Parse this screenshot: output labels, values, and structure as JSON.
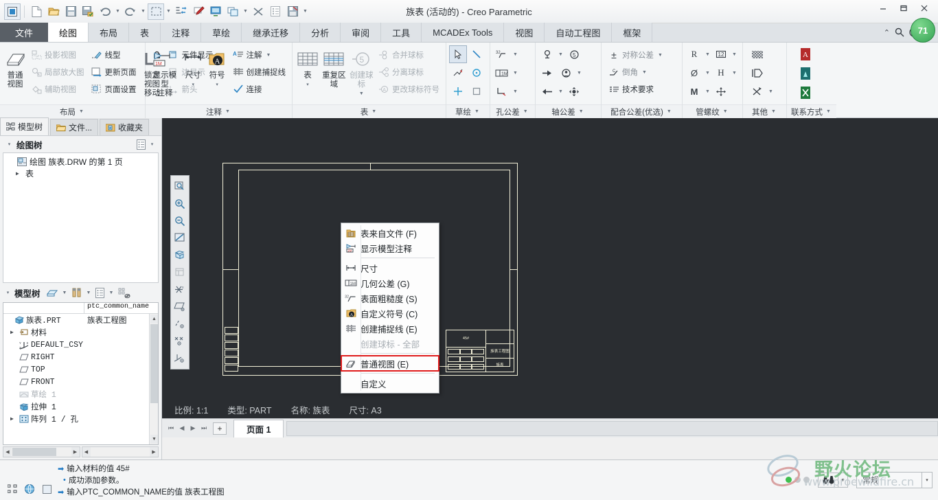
{
  "window": {
    "title": "族表 (活动的) - Creo Parametric",
    "minimize": "—",
    "maximize": "▢",
    "close": "✕"
  },
  "quick_access": {
    "app_icon": "creo-app-icon",
    "items": [
      {
        "name": "new-file-icon",
        "glyph": "🗋"
      },
      {
        "name": "open-file-icon",
        "glyph": "📂"
      },
      {
        "name": "save-icon",
        "glyph": "💾"
      },
      {
        "name": "save-as-icon",
        "glyph": "🗂"
      },
      {
        "name": "undo-icon",
        "glyph": "↺"
      },
      {
        "name": "redo-icon",
        "glyph": "↻"
      },
      {
        "name": "select-box-icon",
        "glyph": "⬚"
      },
      {
        "name": "regenerate-icon",
        "glyph": "⚙"
      },
      {
        "name": "annotate-icon",
        "glyph": "✎"
      },
      {
        "name": "display-icon",
        "glyph": "🖥"
      },
      {
        "name": "window-icon",
        "glyph": "❐"
      },
      {
        "name": "close-window-icon",
        "glyph": "✖"
      },
      {
        "name": "properties-icon",
        "glyph": "📄"
      },
      {
        "name": "save-sheet-icon",
        "glyph": "🖫"
      },
      {
        "name": "more-icon",
        "glyph": "▾"
      }
    ]
  },
  "tabs": [
    {
      "label": "文件",
      "kind": "file"
    },
    {
      "label": "绘图",
      "kind": "active"
    },
    {
      "label": "布局",
      "kind": "normal"
    },
    {
      "label": "表",
      "kind": "normal"
    },
    {
      "label": "注释",
      "kind": "normal"
    },
    {
      "label": "草绘",
      "kind": "normal"
    },
    {
      "label": "继承迁移",
      "kind": "normal"
    },
    {
      "label": "分析",
      "kind": "normal"
    },
    {
      "label": "审阅",
      "kind": "normal"
    },
    {
      "label": "工具",
      "kind": "normal"
    },
    {
      "label": "MCADEx Tools",
      "kind": "normal"
    },
    {
      "label": "视图",
      "kind": "normal"
    },
    {
      "label": "自动工程图",
      "kind": "normal"
    },
    {
      "label": "框架",
      "kind": "normal"
    }
  ],
  "tabstrip_right": {
    "collapse": "⌃",
    "search": "🔍",
    "help": "◕",
    "help_caret": "▾",
    "badge": "71"
  },
  "ribbon": {
    "groups": [
      {
        "label": "布局",
        "big": {
          "label1": "普通视图",
          "label2": "",
          "icon": "general-view-icon"
        },
        "col1": [
          {
            "label": "投影视图",
            "icon": "projection-view-icon",
            "dim": true
          },
          {
            "label": "局部放大图",
            "icon": "detailed-view-icon",
            "dim": true
          },
          {
            "label": "辅助视图",
            "icon": "auxiliary-view-icon",
            "dim": true
          }
        ],
        "col2": [
          {
            "label": "线型",
            "icon": "line-style-icon",
            "dim": false
          },
          {
            "label": "更新页面",
            "icon": "update-sheet-icon",
            "dim": false
          },
          {
            "label": "页面设置",
            "icon": "page-setup-icon",
            "dim": false
          }
        ],
        "big2": {
          "label1": "锁定视图",
          "label2": "移动",
          "icon": "lock-view-icon"
        },
        "col3": [
          {
            "label": "元件显示",
            "icon": "component-display-icon",
            "dim": false
          },
          {
            "label": "边显示",
            "icon": "edge-display-icon",
            "dim": true
          },
          {
            "label": "箭头",
            "icon": "arrows-icon",
            "dim": true
          }
        ]
      },
      {
        "label": "注释",
        "big": {
          "label1": "显示模型",
          "label2": "注释",
          "icon": "show-model-annotations-icon"
        },
        "big_dim": {
          "label1": "尺寸",
          "label2": "▾",
          "icon": "dimension-icon"
        },
        "big_sym": {
          "label1": "符号",
          "label2": "▾",
          "icon": "symbol-icon"
        },
        "col": [
          {
            "label": "注解",
            "icon": "note-icon",
            "caret": true
          },
          {
            "label": "创建捕捉线",
            "icon": "snap-line-icon",
            "caret": false
          },
          {
            "label": "连接",
            "icon": "connect-icon",
            "caret": false
          }
        ]
      },
      {
        "label": "表",
        "big_table": {
          "label1": "表",
          "label2": "▾",
          "icon": "table-icon"
        },
        "big_repeat": {
          "label1": "重复区域",
          "label2": "",
          "icon": "repeat-region-icon"
        },
        "big_balloon": {
          "label1": "创建球标",
          "label2": "▾",
          "icon": "create-balloon-icon",
          "dim": true
        },
        "col": [
          {
            "label": "合并球标",
            "icon": "merge-balloons-icon",
            "dim": true
          },
          {
            "label": "分离球标",
            "icon": "split-balloons-icon",
            "dim": true
          },
          {
            "label": "更改球标符号",
            "icon": "change-balloon-symbol-icon",
            "dim": true
          }
        ]
      },
      {
        "label": "草绘",
        "icons": [
          [
            "select-arrow-icon",
            "line-icon"
          ],
          [
            "sketch-chain-icon",
            "circle-icon"
          ],
          [
            "point-icon",
            "rectangle-icon"
          ]
        ],
        "glyphs": [
          [
            "➤",
            "╲"
          ],
          [
            "✎",
            "◎"
          ],
          [
            "✛",
            "▭"
          ]
        ]
      },
      {
        "label": "孔公差",
        "glyphs": [
          [
            "³²√",
            "▾"
          ],
          [
            "▣1M",
            "▾"
          ],
          [
            "⌐",
            "▾"
          ]
        ]
      },
      {
        "label": "轴公差",
        "glyphs": [
          [
            "⊕",
            "▾",
            "⑤"
          ],
          [
            "➤",
            "⊛",
            "▾"
          ],
          [
            "←",
            "▾",
            "✜"
          ]
        ]
      },
      {
        "label": "配合公差(优选)",
        "rows": [
          {
            "glyph": "±",
            "label": "对称公差",
            "caret": true
          },
          {
            "glyph": "⌐",
            "label": "倒角",
            "caret": true
          },
          {
            "glyph": "≣",
            "label": "技术要求",
            "caret": false
          }
        ]
      },
      {
        "label": "管螺纹",
        "rows": [
          {
            "a": "R",
            "b": "▾",
            "c": "⑫",
            "d": "▾"
          },
          {
            "a": "Ø",
            "b": "▾",
            "c": "H",
            "d": "▾"
          },
          {
            "a": "M",
            "b": "▾",
            "c": "✜",
            "d": ""
          }
        ]
      },
      {
        "label": "其他",
        "glyphs": [
          "▦",
          "◫",
          "⧄"
        ]
      },
      {
        "label": "联系方式",
        "glyphs": [
          "pdf-icon",
          "cad-icon",
          "excel-icon"
        ]
      }
    ]
  },
  "left_panel": {
    "tabs": [
      {
        "label": "模型树",
        "icon": "model-tree-icon",
        "active": true
      },
      {
        "label": "文件...",
        "icon": "folder-icon",
        "active": false
      },
      {
        "label": "收藏夹",
        "icon": "favorites-icon",
        "active": false
      }
    ],
    "drawing_tree": {
      "header": "绘图树",
      "header_caret": "▾",
      "settings_icon": "list-settings-icon",
      "settings_caret": "▾",
      "nodes": [
        {
          "label": "绘图 族表.DRW 的第 1 页",
          "icon": "drawing-icon",
          "arrow": ""
        },
        {
          "label": "表",
          "icon": "",
          "arrow": "▶"
        }
      ]
    },
    "model_tree": {
      "header": "模型树",
      "header_caret": "▾",
      "toolbar": [
        {
          "name": "filter-icon",
          "glyph": "▱",
          "caret": "▾"
        },
        {
          "name": "settings-tools-icon",
          "glyph": "🛠",
          "caret": "▾"
        },
        {
          "name": "list-columns-icon",
          "glyph": "▤",
          "caret": "▾"
        },
        {
          "name": "tree-display-icon",
          "glyph": "⬓"
        }
      ],
      "columns": [
        "",
        "ptc_common_name"
      ],
      "rows": [
        {
          "label": "族表.PRT",
          "value": "族表工程图",
          "icon": "part-icon",
          "arrow": "",
          "indent": 0,
          "dim": false
        },
        {
          "label": "材料",
          "value": "",
          "icon": "material-icon",
          "arrow": "▶",
          "indent": 1,
          "dim": false
        },
        {
          "label": "DEFAULT_CSY",
          "value": "",
          "icon": "csys-icon",
          "arrow": "",
          "indent": 1,
          "dim": false
        },
        {
          "label": "RIGHT",
          "value": "",
          "icon": "plane-icon",
          "arrow": "",
          "indent": 1,
          "dim": false
        },
        {
          "label": "TOP",
          "value": "",
          "icon": "plane-icon",
          "arrow": "",
          "indent": 1,
          "dim": false
        },
        {
          "label": "FRONT",
          "value": "",
          "icon": "plane-icon",
          "arrow": "",
          "indent": 1,
          "dim": false
        },
        {
          "label": "草绘 1",
          "value": "",
          "icon": "sketch-icon",
          "arrow": "",
          "indent": 1,
          "dim": true
        },
        {
          "label": "拉伸 1",
          "value": "",
          "icon": "extrude-icon",
          "arrow": "",
          "indent": 1,
          "dim": false
        },
        {
          "label": "阵列 1 / 孔",
          "value": "",
          "icon": "pattern-icon",
          "arrow": "▶",
          "indent": 1,
          "dim": false
        }
      ]
    }
  },
  "graphics_toolbar": [
    {
      "name": "refit-icon",
      "glyph": "🔍"
    },
    {
      "name": "zoom-in-icon",
      "glyph": "⊕"
    },
    {
      "name": "zoom-out-icon",
      "glyph": "⊖"
    },
    {
      "name": "repaint-icon",
      "glyph": "◩"
    },
    {
      "name": "display-style-icon",
      "glyph": "▱"
    },
    {
      "name": "sheet-display-icon",
      "glyph": "▤"
    },
    {
      "name": "datum-display-icon",
      "glyph": "✻"
    },
    {
      "name": "plane-display-icon",
      "glyph": "▱"
    },
    {
      "name": "axis-display-icon",
      "glyph": "⁄"
    },
    {
      "name": "point-display-icon",
      "glyph": "✕"
    },
    {
      "name": "csys-display-icon",
      "glyph": "⋎"
    }
  ],
  "drawing": {
    "title_block": {
      "material": "45#",
      "name_cn": "族表工程图",
      "short_name": "族表"
    }
  },
  "status_line": {
    "scale": "比例: 1:1",
    "type": "类型: PART",
    "name": "名称: 族表",
    "size": "尺寸: A3"
  },
  "page_tabs": {
    "nav": [
      "⏮",
      "◀",
      "▶",
      "⏭"
    ],
    "add": "+",
    "tabs": [
      {
        "label": "页面 1",
        "active": true
      }
    ]
  },
  "context_menu": {
    "items": [
      {
        "label": "表来自文件 (F)",
        "icon": "table-from-file-icon",
        "glyph": "▤",
        "dim": false,
        "sep_after": false
      },
      {
        "label": "显示模型注释",
        "icon": "show-model-annotations-icon",
        "glyph": "◣",
        "dim": false,
        "sep_after": true
      },
      {
        "label": "尺寸",
        "icon": "dimension-icon",
        "glyph": "↔",
        "dim": false,
        "sep_after": false
      },
      {
        "label": "几何公差 (G)",
        "icon": "geometric-tolerance-icon",
        "glyph": "▣",
        "dim": false,
        "sep_after": false
      },
      {
        "label": "表面粗糙度 (S)",
        "icon": "surface-finish-icon",
        "glyph": "√",
        "dim": false,
        "sep_after": false
      },
      {
        "label": "自定义符号 (C)",
        "icon": "custom-symbol-icon",
        "glyph": "Ⓐ",
        "dim": false,
        "sep_after": false
      },
      {
        "label": "创建捕捉线 (E)",
        "icon": "snap-line-icon",
        "glyph": "≣",
        "dim": false,
        "sep_after": false
      },
      {
        "label": "创建球标 - 全部",
        "icon": "create-balloon-all-icon",
        "glyph": "",
        "dim": true,
        "sep_after": true
      },
      {
        "label": "普通视图 (E)",
        "icon": "general-view-icon",
        "glyph": "◲",
        "dim": false,
        "sep_after": true,
        "highlight": true
      },
      {
        "label": "自定义",
        "icon": "",
        "glyph": "",
        "dim": false,
        "sep_after": false
      }
    ]
  },
  "messages": [
    {
      "kind": "arrow",
      "text": "输入材料的值  45#"
    },
    {
      "kind": "dot",
      "text": "成功添加参数。"
    },
    {
      "kind": "arrow",
      "text": "输入PTC_COMMON_NAME的值  族表工程图"
    }
  ],
  "message_icons": [
    {
      "name": "model-tree-toggle-icon",
      "glyph": "⛶"
    },
    {
      "name": "browser-icon",
      "glyph": "🌐"
    },
    {
      "name": "window-toggle-icon",
      "glyph": "▢"
    }
  ],
  "status_right": {
    "leds": [
      true,
      false,
      false
    ],
    "search_icon": "binoculars-icon",
    "search_caret": "▾",
    "mode_label": "常规",
    "mode_caret": "▾"
  },
  "watermark": {
    "text": "野火论坛",
    "url": "www.proewildfire.cn"
  },
  "colors": {
    "accent": "#1d79c4",
    "graphics_bg": "#2a2d31",
    "sheet_line": "#f2f0d8",
    "highlight_red": "#e01b1b",
    "badge_green": "#35a354"
  }
}
